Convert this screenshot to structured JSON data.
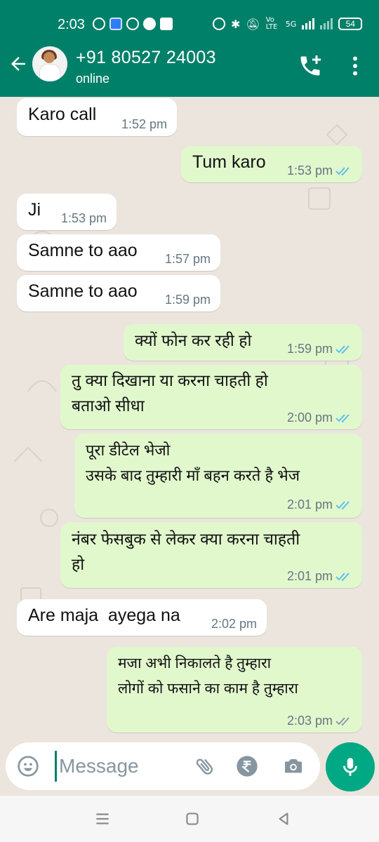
{
  "status_bar": {
    "time": "2:03",
    "volte": "Vo LTE",
    "network": "5G",
    "battery": "54"
  },
  "header": {
    "contact_name": "+91 80527 24003",
    "contact_status": "online"
  },
  "messages": [
    {
      "dir": "in",
      "lines": "Karo call",
      "time": "1:52 pm"
    },
    {
      "dir": "out",
      "lines": "Tum karo",
      "time": "1:53 pm",
      "ticks": "read"
    },
    {
      "dir": "in",
      "lines": "Ji",
      "time": "1:53 pm"
    },
    {
      "dir": "in",
      "lines": "Samne to aao",
      "time": "1:57 pm"
    },
    {
      "dir": "in",
      "lines": "Samne to aao",
      "time": "1:59 pm"
    },
    {
      "dir": "out",
      "lines": "क्यों फोन कर रही हो",
      "time": "1:59 pm",
      "ticks": "read"
    },
    {
      "dir": "out",
      "lines": "तु क्या दिखाना या करना चाहती हो\nबताओ सीधा",
      "time": "2:00 pm",
      "ticks": "read"
    },
    {
      "dir": "out",
      "lines": "पूरा डीटेल भेजो\nउसके बाद तुम्हारी माँ बहन करते है भेज",
      "time": "2:01 pm",
      "ticks": "read"
    },
    {
      "dir": "out",
      "lines": "नंबर फेसबुक से लेकर क्या करना चाहती\nहो",
      "time": "2:01 pm",
      "ticks": "read"
    },
    {
      "dir": "in",
      "lines": "Are maja  ayega na",
      "time": "2:02 pm"
    },
    {
      "dir": "out",
      "lines": "मजा अभी निकालते है तुम्हारा\nलोगों को फसाने का काम है तुम्हारा",
      "time": "2:03 pm",
      "ticks": "delivered"
    }
  ],
  "input": {
    "placeholder": "Message"
  },
  "colors": {
    "header": "#008069",
    "chat_bg": "#ece5dd",
    "bubble_out": "#e1f8cd",
    "bubble_in": "#ffffff",
    "read_tick": "#53bdeb",
    "delivered_tick": "#8696a0",
    "mic_button": "#00a884"
  },
  "icons": {
    "back": "arrow-left-icon",
    "add_call": "add-call-icon",
    "menu": "more-vert-icon",
    "emoji": "emoji-icon",
    "attach": "paperclip-icon",
    "payment": "rupee-icon",
    "camera": "camera-icon",
    "mic": "microphone-icon"
  }
}
